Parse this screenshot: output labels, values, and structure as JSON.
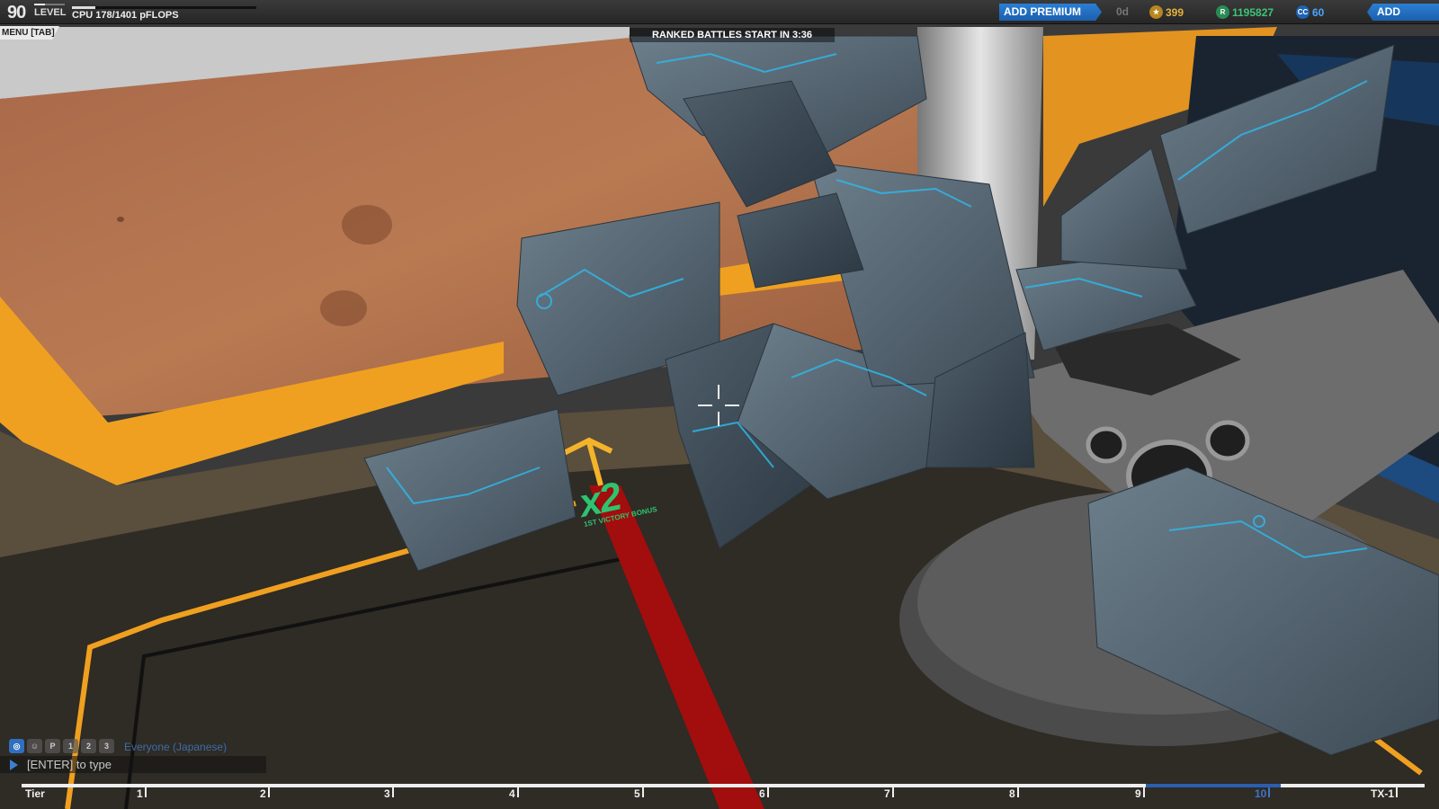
{
  "hud": {
    "level_value": "90",
    "level_label": "LEVEL",
    "level_progress": 0.35,
    "cpu_label": "CPU 178/1401 pFLOPS",
    "cpu_progress": 0.127,
    "premium_button": "ADD PREMIUM",
    "premium_days": "0d",
    "tech_points": "399",
    "robits": "1195827",
    "cosmetic_credits": "60",
    "funds_button": "ADD FUNDS",
    "menu_tab": "MENU [TAB]",
    "ranked_banner": "RANKED BATTLES START IN 3:36"
  },
  "icons": {
    "tech_points": "tech-points-icon",
    "robits": "robits-icon",
    "cosmetic_credits": "cosmetic-credits-icon"
  },
  "bonus": {
    "multiplier": "x2",
    "label": "1ST VICTORY BONUS"
  },
  "chat": {
    "channel": "Everyone (Japanese)",
    "placeholder": "[ENTER] to type",
    "channel_tabs": [
      "global-chat-icon",
      "social-chat-icon",
      "party-chat-icon",
      "team-1-chat-icon",
      "team-2-chat-icon",
      "team-3-chat-icon"
    ]
  },
  "tiers": {
    "labels": [
      "Tier",
      "1",
      "2",
      "3",
      "4",
      "5",
      "6",
      "7",
      "8",
      "9",
      "10",
      "TX-1"
    ],
    "current_index": 10
  },
  "colors": {
    "accent_blue": "#2a7fd4",
    "tech_points": "#e7b23d",
    "robits": "#3fc47a",
    "cosmetic_credits": "#4aa6ff",
    "bonus_green": "#2ec46f",
    "floor_orange": "#f0a020"
  }
}
